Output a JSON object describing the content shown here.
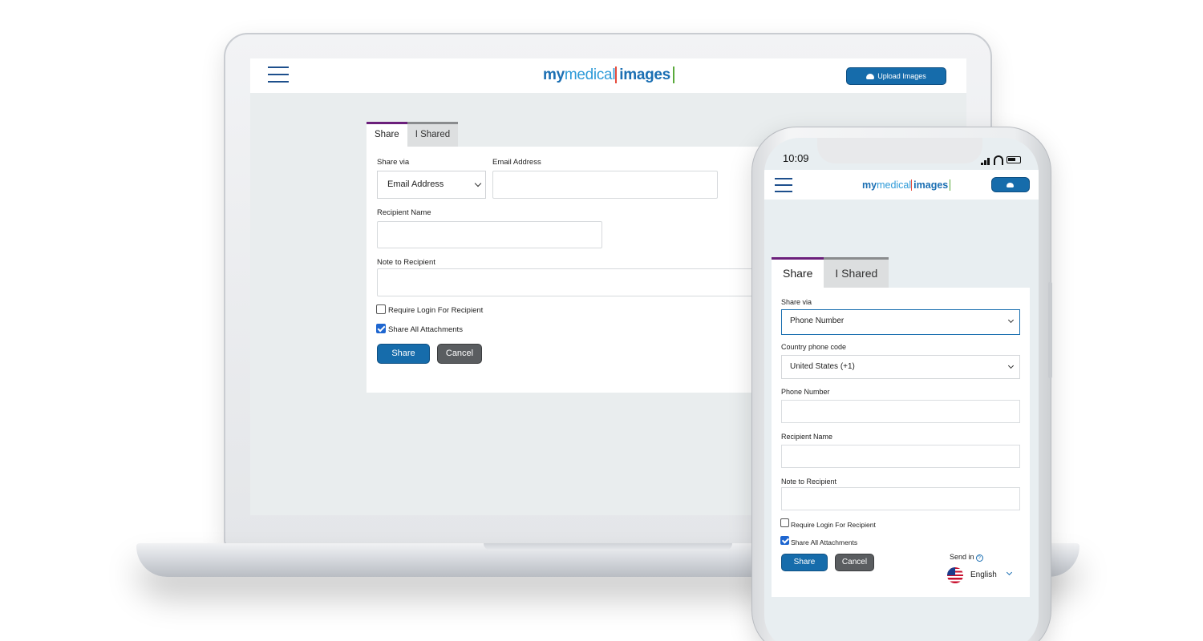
{
  "laptop": {
    "header": {
      "logo_my": "my",
      "logo_medical": "medical",
      "logo_images": "images",
      "upload_label": "Upload Images"
    },
    "tabs": [
      {
        "label": "Share",
        "active": true
      },
      {
        "label": "I Shared",
        "active": false
      }
    ],
    "form": {
      "share_via_label": "Share via",
      "share_via_value": "Email Address",
      "email_label": "Email Address",
      "recipient_label": "Recipient Name",
      "note_label": "Note to Recipient",
      "require_login_label": "Require Login For Recipient",
      "require_login_checked": false,
      "share_all_label": "Share All Attachments",
      "share_all_checked": true,
      "share_button": "Share",
      "cancel_button": "Cancel"
    }
  },
  "phone": {
    "status": {
      "time": "10:09"
    },
    "header": {
      "logo_my": "my",
      "logo_medical": "medical",
      "logo_images": "images"
    },
    "tabs": [
      {
        "label": "Share",
        "active": true
      },
      {
        "label": "I Shared",
        "active": false
      }
    ],
    "form": {
      "share_via_label": "Share via",
      "share_via_value": "Phone Number",
      "country_label": "Country phone code",
      "country_value": "United States (+1)",
      "phone_label": "Phone Number",
      "recipient_label": "Recipient Name",
      "note_label": "Note to Recipient",
      "require_login_label": "Require Login For Recipient",
      "require_login_checked": false,
      "share_all_label": "Share All Attachments",
      "share_all_checked": true,
      "share_button": "Share",
      "cancel_button": "Cancel",
      "send_in_label": "Send in",
      "help_glyph": "?",
      "language_value": "English"
    }
  },
  "colors": {
    "brand_blue": "#166cab",
    "tab_accent_purple": "#6b1f7b",
    "checkbox_blue": "#1e66d0",
    "cancel_gray": "#5a5d60"
  },
  "icons": [
    "hamburger-menu-icon",
    "cloud-upload-icon",
    "chevron-down-icon",
    "checkbox-checked-icon",
    "help-icon",
    "us-flag-icon",
    "signal-icon",
    "wifi-icon",
    "battery-icon"
  ]
}
